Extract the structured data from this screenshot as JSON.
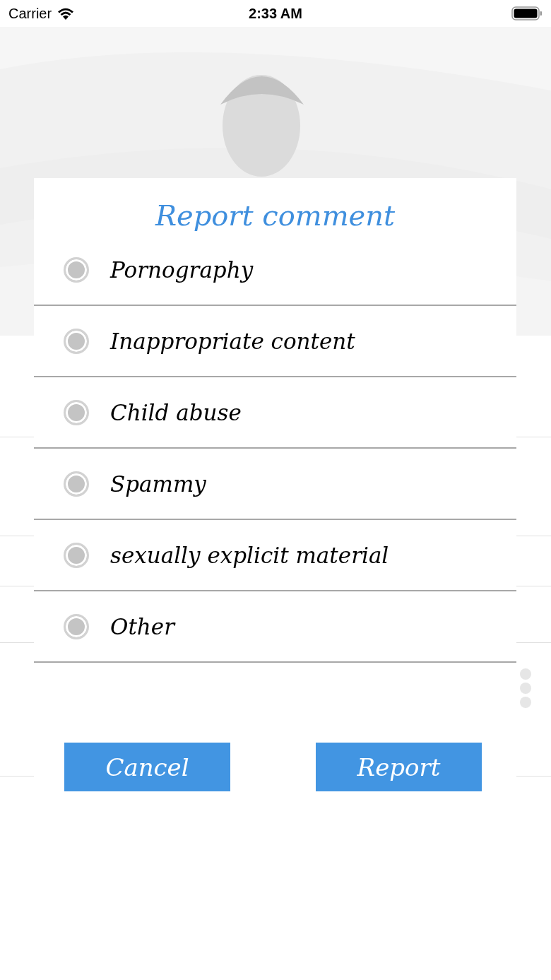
{
  "status_bar": {
    "carrier": "Carrier",
    "time": "2:33 AM"
  },
  "dialog": {
    "title": "Report comment",
    "options": [
      {
        "label": "Pornography",
        "selected": false
      },
      {
        "label": "Inappropriate content",
        "selected": false
      },
      {
        "label": "Child abuse",
        "selected": false
      },
      {
        "label": "Spammy",
        "selected": false
      },
      {
        "label": "sexually explicit material",
        "selected": false
      },
      {
        "label": "Other",
        "selected": false
      }
    ],
    "buttons": [
      "Cancel",
      "Report"
    ]
  }
}
